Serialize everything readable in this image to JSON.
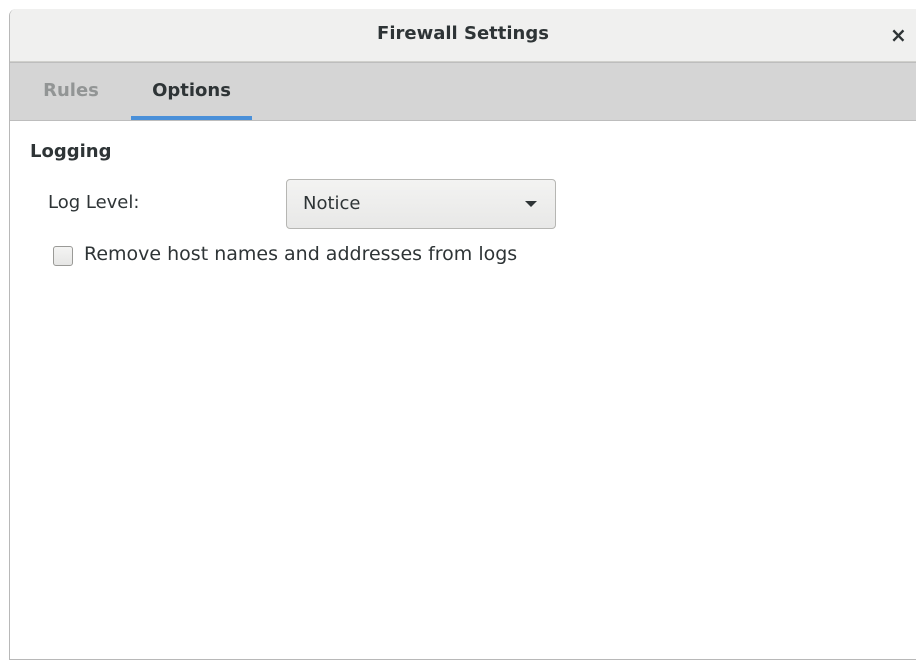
{
  "window": {
    "title": "Firewall Settings",
    "close_label": "×"
  },
  "tabs": [
    {
      "label": "Rules",
      "active": false
    },
    {
      "label": "Options",
      "active": true
    }
  ],
  "logging": {
    "section_title": "Logging",
    "log_level_label": "Log Level:",
    "log_level_value": "Notice",
    "remove_hosts_label": "Remove host names and addresses from logs",
    "remove_hosts_checked": false
  },
  "colors": {
    "accent": "#4a90d9",
    "text": "#2e3436",
    "inactive_tab_text": "#929595",
    "tabbar_bg": "#d5d5d5"
  }
}
